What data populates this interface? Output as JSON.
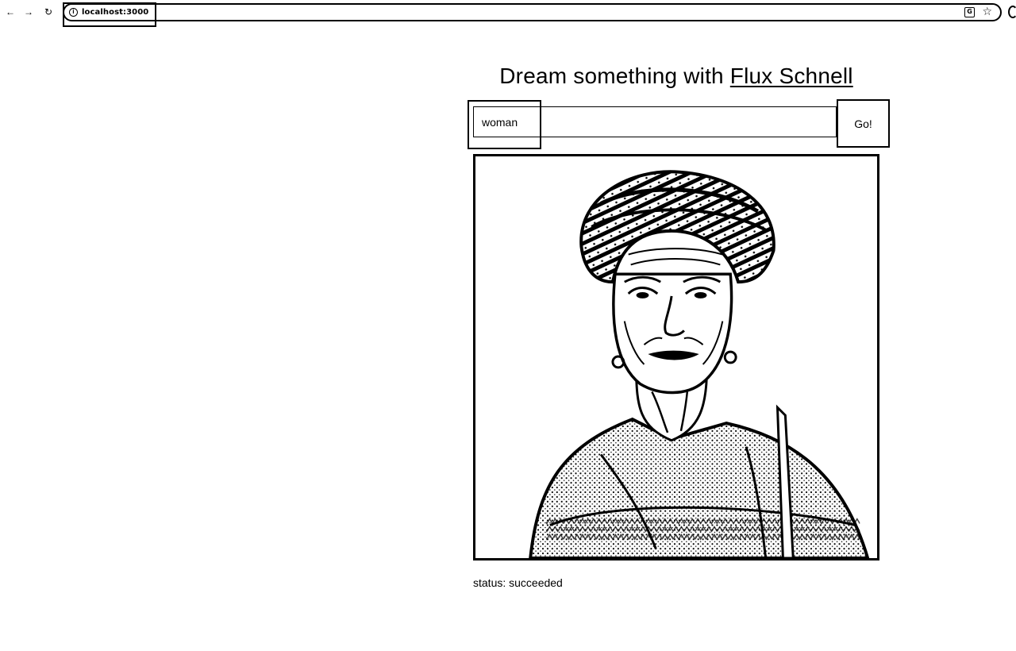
{
  "browser": {
    "url": "localhost:3000",
    "icons": {
      "back": "arrow-left-icon",
      "forward": "arrow-right-icon",
      "reload": "reload-icon",
      "site_info": "info-icon",
      "translate": "translate-icon",
      "bookmark": "star-icon",
      "extension": "extension-icon"
    }
  },
  "heading": {
    "prefix": "Dream something with ",
    "link_text": "Flux Schnell"
  },
  "form": {
    "prompt_value": "woman",
    "submit_label": "Go!"
  },
  "result": {
    "image_alt": "Generated portrait of an elderly woman wearing a patterned head wrap and embroidered blouse"
  },
  "status": {
    "text": "status: succeeded"
  }
}
